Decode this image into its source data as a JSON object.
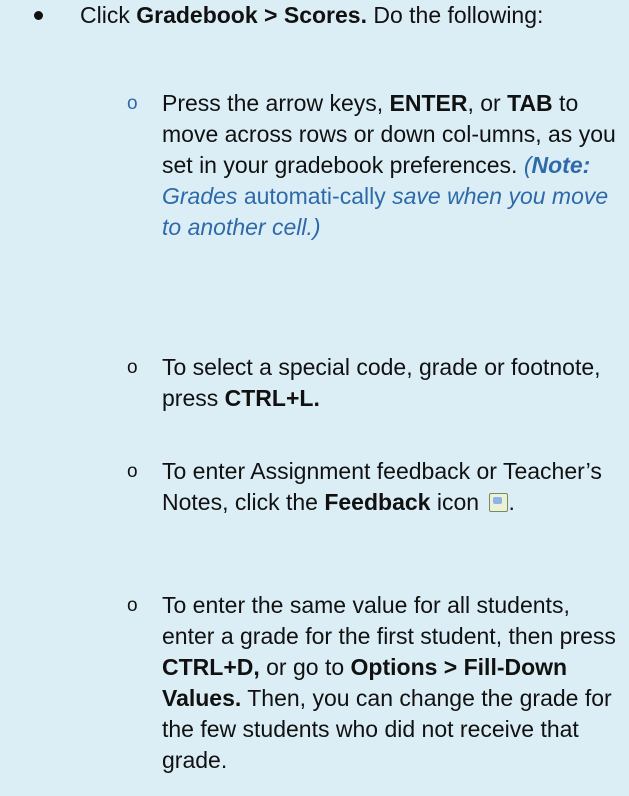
{
  "main": {
    "bullet_lead": "Click ",
    "bullet_bold": "Gradebook > Scores.",
    "bullet_rest": " Do the following:"
  },
  "steps": [
    {
      "marker": "o",
      "t1": "Press the arrow keys, ",
      "b1": "ENTER",
      "t2": ", or ",
      "b2": "TAB",
      "t3": " to move across rows or down col-umns, as you set in your gradebook preferences. ",
      "note_open": "(",
      "note_bold": "Note:",
      "note_t1": " Grades",
      "note_t2": " automati-cally",
      "note_t3": " save when you move to another cell.)"
    },
    {
      "marker": "o",
      "t1": "To select a special code, grade or footnote, press ",
      "b1": "CTRL+L."
    },
    {
      "marker": "o",
      "t1": "To enter Assignment feedback or Teacher’s Notes, click the ",
      "b1": "Feedback",
      "t2": " icon ",
      "icon": "feedback-icon",
      "t3": "."
    },
    {
      "marker": "o",
      "t1": "To enter the same value for all students, enter a grade for the first student, then press ",
      "b1": "CTRL+D,",
      "t2": " or go to ",
      "b2": "Options > Fill-Down Values.",
      "t3": " Then, you can change the grade for the few students who did not receive that grade."
    }
  ]
}
